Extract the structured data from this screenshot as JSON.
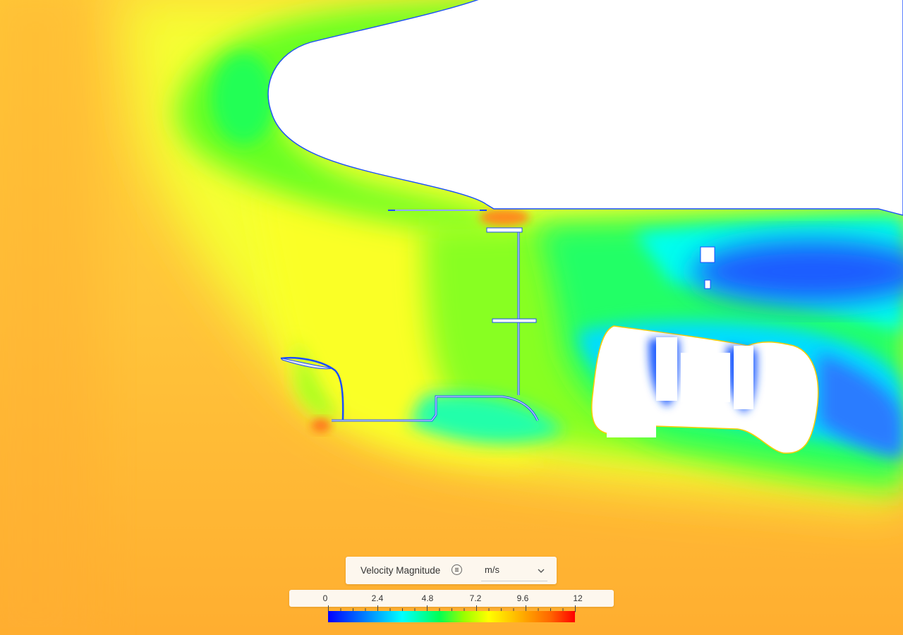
{
  "legend": {
    "field_name": "Velocity Magnitude",
    "field_menu_icon": "list-menu-icon",
    "unit": "m/s",
    "unit_dropdown_icon": "chevron-down-icon",
    "min": 0,
    "max": 12,
    "tick_labels": [
      "0",
      "2.4",
      "4.8",
      "7.2",
      "9.6",
      "12"
    ],
    "colormap": [
      "#0000ff",
      "#0077ff",
      "#00ffff",
      "#00ff55",
      "#99ff00",
      "#ffff00",
      "#ffb000",
      "#ff6600",
      "#ff0000"
    ]
  },
  "colors": {
    "far_field": "#ffb833",
    "mid_flow": "#ffff33",
    "wake_low": "#00ffdd",
    "wake_lowest": "#1e5cff",
    "solid": "#ffffff"
  }
}
